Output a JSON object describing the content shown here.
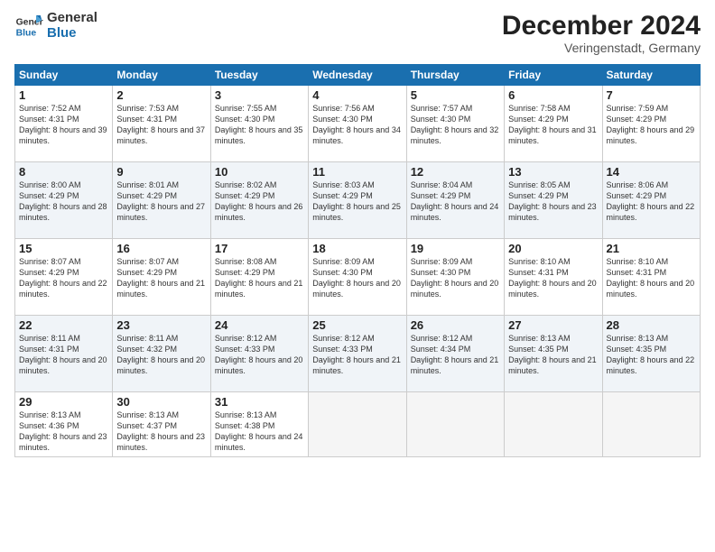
{
  "header": {
    "logo_line1": "General",
    "logo_line2": "Blue",
    "month": "December 2024",
    "location": "Veringenstadt, Germany"
  },
  "weekdays": [
    "Sunday",
    "Monday",
    "Tuesday",
    "Wednesday",
    "Thursday",
    "Friday",
    "Saturday"
  ],
  "weeks": [
    [
      {
        "day": "1",
        "sunrise": "7:52 AM",
        "sunset": "4:31 PM",
        "daylight": "8 hours and 39 minutes."
      },
      {
        "day": "2",
        "sunrise": "7:53 AM",
        "sunset": "4:31 PM",
        "daylight": "8 hours and 37 minutes."
      },
      {
        "day": "3",
        "sunrise": "7:55 AM",
        "sunset": "4:30 PM",
        "daylight": "8 hours and 35 minutes."
      },
      {
        "day": "4",
        "sunrise": "7:56 AM",
        "sunset": "4:30 PM",
        "daylight": "8 hours and 34 minutes."
      },
      {
        "day": "5",
        "sunrise": "7:57 AM",
        "sunset": "4:30 PM",
        "daylight": "8 hours and 32 minutes."
      },
      {
        "day": "6",
        "sunrise": "7:58 AM",
        "sunset": "4:29 PM",
        "daylight": "8 hours and 31 minutes."
      },
      {
        "day": "7",
        "sunrise": "7:59 AM",
        "sunset": "4:29 PM",
        "daylight": "8 hours and 29 minutes."
      }
    ],
    [
      {
        "day": "8",
        "sunrise": "8:00 AM",
        "sunset": "4:29 PM",
        "daylight": "8 hours and 28 minutes."
      },
      {
        "day": "9",
        "sunrise": "8:01 AM",
        "sunset": "4:29 PM",
        "daylight": "8 hours and 27 minutes."
      },
      {
        "day": "10",
        "sunrise": "8:02 AM",
        "sunset": "4:29 PM",
        "daylight": "8 hours and 26 minutes."
      },
      {
        "day": "11",
        "sunrise": "8:03 AM",
        "sunset": "4:29 PM",
        "daylight": "8 hours and 25 minutes."
      },
      {
        "day": "12",
        "sunrise": "8:04 AM",
        "sunset": "4:29 PM",
        "daylight": "8 hours and 24 minutes."
      },
      {
        "day": "13",
        "sunrise": "8:05 AM",
        "sunset": "4:29 PM",
        "daylight": "8 hours and 23 minutes."
      },
      {
        "day": "14",
        "sunrise": "8:06 AM",
        "sunset": "4:29 PM",
        "daylight": "8 hours and 22 minutes."
      }
    ],
    [
      {
        "day": "15",
        "sunrise": "8:07 AM",
        "sunset": "4:29 PM",
        "daylight": "8 hours and 22 minutes."
      },
      {
        "day": "16",
        "sunrise": "8:07 AM",
        "sunset": "4:29 PM",
        "daylight": "8 hours and 21 minutes."
      },
      {
        "day": "17",
        "sunrise": "8:08 AM",
        "sunset": "4:29 PM",
        "daylight": "8 hours and 21 minutes."
      },
      {
        "day": "18",
        "sunrise": "8:09 AM",
        "sunset": "4:30 PM",
        "daylight": "8 hours and 20 minutes."
      },
      {
        "day": "19",
        "sunrise": "8:09 AM",
        "sunset": "4:30 PM",
        "daylight": "8 hours and 20 minutes."
      },
      {
        "day": "20",
        "sunrise": "8:10 AM",
        "sunset": "4:31 PM",
        "daylight": "8 hours and 20 minutes."
      },
      {
        "day": "21",
        "sunrise": "8:10 AM",
        "sunset": "4:31 PM",
        "daylight": "8 hours and 20 minutes."
      }
    ],
    [
      {
        "day": "22",
        "sunrise": "8:11 AM",
        "sunset": "4:31 PM",
        "daylight": "8 hours and 20 minutes."
      },
      {
        "day": "23",
        "sunrise": "8:11 AM",
        "sunset": "4:32 PM",
        "daylight": "8 hours and 20 minutes."
      },
      {
        "day": "24",
        "sunrise": "8:12 AM",
        "sunset": "4:33 PM",
        "daylight": "8 hours and 20 minutes."
      },
      {
        "day": "25",
        "sunrise": "8:12 AM",
        "sunset": "4:33 PM",
        "daylight": "8 hours and 21 minutes."
      },
      {
        "day": "26",
        "sunrise": "8:12 AM",
        "sunset": "4:34 PM",
        "daylight": "8 hours and 21 minutes."
      },
      {
        "day": "27",
        "sunrise": "8:13 AM",
        "sunset": "4:35 PM",
        "daylight": "8 hours and 21 minutes."
      },
      {
        "day": "28",
        "sunrise": "8:13 AM",
        "sunset": "4:35 PM",
        "daylight": "8 hours and 22 minutes."
      }
    ],
    [
      {
        "day": "29",
        "sunrise": "8:13 AM",
        "sunset": "4:36 PM",
        "daylight": "8 hours and 23 minutes."
      },
      {
        "day": "30",
        "sunrise": "8:13 AM",
        "sunset": "4:37 PM",
        "daylight": "8 hours and 23 minutes."
      },
      {
        "day": "31",
        "sunrise": "8:13 AM",
        "sunset": "4:38 PM",
        "daylight": "8 hours and 24 minutes."
      },
      null,
      null,
      null,
      null
    ]
  ]
}
